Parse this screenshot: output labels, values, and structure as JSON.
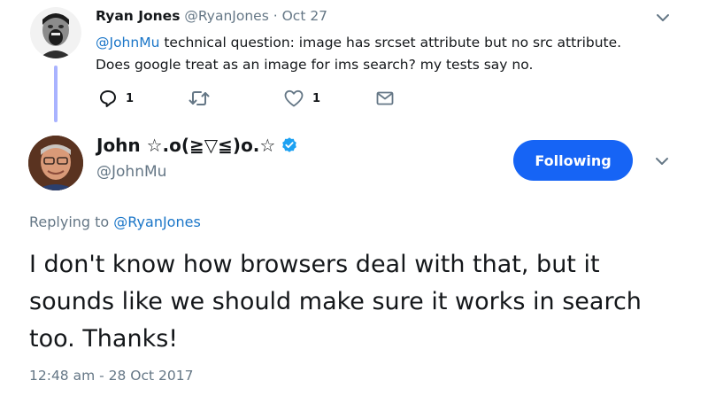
{
  "parent_tweet": {
    "author_name": "Ryan Jones",
    "author_handle": "@RyanJones",
    "separator": "·",
    "time": "Oct 27",
    "mention": "@JohnMu",
    "text_line1_rest": " technical question: image has srcset attribute but no src attribute.",
    "text_line2": "Does google treat as an image for ims search? my tests say no.",
    "actions": {
      "reply_icon": "reply-icon",
      "reply_count": "1",
      "retweet_icon": "retweet-icon",
      "like_icon": "heart-icon",
      "like_count": "1",
      "dm_icon": "envelope-icon"
    }
  },
  "main_tweet": {
    "author_name": "John ☆.o(≧▽≦)o.☆",
    "verified_icon": "verified-badge-icon",
    "author_handle": "@JohnMu",
    "follow_button_label": "Following",
    "replying_prefix": "Replying to ",
    "replying_handle": "@RyanJones",
    "text": "I don't know how browsers deal with that, but it sounds like we should make sure it works in search too. Thanks!",
    "timestamp": "12:48 am - 28 Oct 2017"
  },
  "colors": {
    "link": "#1b76c8",
    "follow_button": "#1664f5",
    "thread_line": "#a9b3ff",
    "muted": "#657786",
    "text": "#14171a"
  }
}
